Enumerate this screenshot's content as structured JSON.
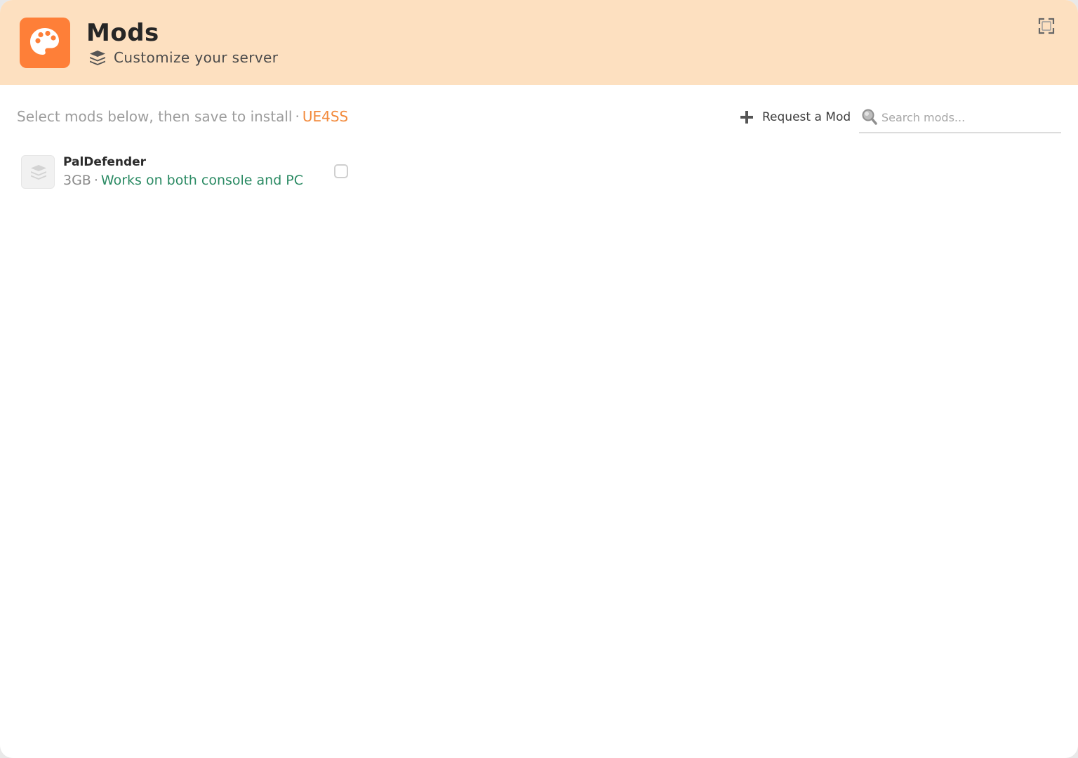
{
  "header": {
    "title": "Mods",
    "subtitle": "Customize your server",
    "app_icon": "palette-icon",
    "subtitle_icon": "layers-icon",
    "expand_icon": "expand-icon",
    "background_color": "#fde0c0",
    "accent_color": "#fe7f38"
  },
  "toolbar": {
    "hint_text": "Select mods below, then save to install",
    "separator": "·",
    "framework_label": "UE4SS",
    "framework_color": "#f28a3c",
    "request_button_label": "Request a Mod",
    "request_button_icon": "plus-icon",
    "search_placeholder": "Search mods...",
    "search_value": "",
    "search_icon": "search-icon"
  },
  "mods": [
    {
      "name": "PalDefender",
      "size": "3GB",
      "separator": "·",
      "compatibility": "Works on both console and PC",
      "compatibility_color": "#2a8a63",
      "thumbnail_icon": "layers-icon",
      "selected": false
    }
  ]
}
